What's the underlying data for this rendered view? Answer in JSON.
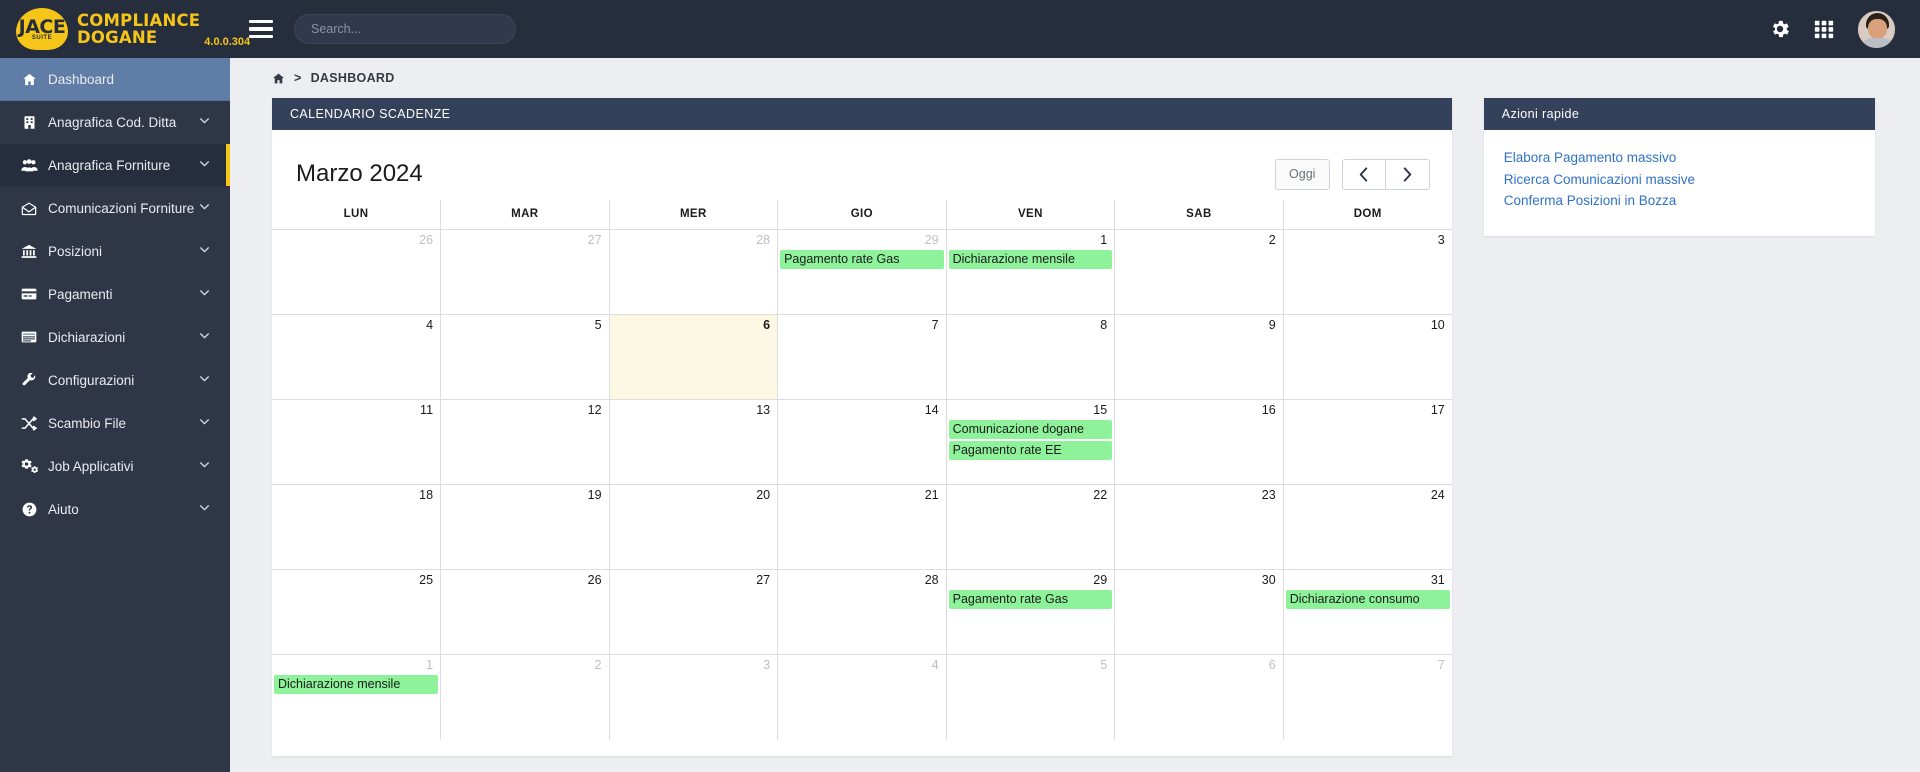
{
  "topbar": {
    "logo_word": "JACE",
    "logo_sub": "SUITE",
    "brand_line1": "COMPLIANCE",
    "brand_line2": "DOGANE",
    "version": "4.0.0.304",
    "search_placeholder": "Search...",
    "search_value": "",
    "icons": [
      "gear-icon",
      "grid-apps-icon",
      "user-avatar"
    ]
  },
  "sidebar": {
    "items": [
      {
        "label": "Dashboard",
        "icon": "home-icon",
        "caret": false,
        "state": "active"
      },
      {
        "label": "Anagrafica Cod. Ditta",
        "icon": "building-icon",
        "caret": true,
        "state": "normal"
      },
      {
        "label": "Anagrafica Forniture",
        "icon": "users-icon",
        "caret": true,
        "state": "hovered"
      },
      {
        "label": "Comunicazioni Forniture",
        "icon": "envelope-icon",
        "caret": true,
        "state": "normal"
      },
      {
        "label": "Posizioni",
        "icon": "bank-icon",
        "caret": true,
        "state": "normal"
      },
      {
        "label": "Pagamenti",
        "icon": "card-icon",
        "caret": true,
        "state": "normal"
      },
      {
        "label": "Dichiarazioni",
        "icon": "list-icon",
        "caret": true,
        "state": "normal"
      },
      {
        "label": "Configurazioni",
        "icon": "wrench-icon",
        "caret": true,
        "state": "normal"
      },
      {
        "label": "Scambio File",
        "icon": "shuffle-icon",
        "caret": true,
        "state": "normal"
      },
      {
        "label": "Job Applicativi",
        "icon": "cogs-icon",
        "caret": true,
        "state": "normal"
      },
      {
        "label": "Aiuto",
        "icon": "question-icon",
        "caret": true,
        "state": "normal"
      }
    ]
  },
  "breadcrumb": {
    "home_icon": "home-icon",
    "separator": ">",
    "current": "DASHBOARD"
  },
  "calendar_panel": {
    "header": "CALENDARIO SCADENZE",
    "title": "Marzo 2024",
    "today_label": "Oggi",
    "prev_label": "‹",
    "next_label": "›",
    "weekdays": [
      "LUN",
      "MAR",
      "MER",
      "GIO",
      "VEN",
      "SAB",
      "DOM"
    ],
    "event_color": "#8ef29a",
    "today_color": "#fcf8e3",
    "weeks": [
      [
        {
          "day": "26",
          "other": true,
          "today": false,
          "events": []
        },
        {
          "day": "27",
          "other": true,
          "today": false,
          "events": []
        },
        {
          "day": "28",
          "other": true,
          "today": false,
          "events": []
        },
        {
          "day": "29",
          "other": true,
          "today": false,
          "events": [
            "Pagamento rate Gas"
          ]
        },
        {
          "day": "1",
          "other": false,
          "today": false,
          "events": [
            "Dichiarazione mensile"
          ]
        },
        {
          "day": "2",
          "other": false,
          "today": false,
          "events": []
        },
        {
          "day": "3",
          "other": false,
          "today": false,
          "events": []
        }
      ],
      [
        {
          "day": "4",
          "other": false,
          "today": false,
          "events": []
        },
        {
          "day": "5",
          "other": false,
          "today": false,
          "events": []
        },
        {
          "day": "6",
          "other": false,
          "today": true,
          "events": []
        },
        {
          "day": "7",
          "other": false,
          "today": false,
          "events": []
        },
        {
          "day": "8",
          "other": false,
          "today": false,
          "events": []
        },
        {
          "day": "9",
          "other": false,
          "today": false,
          "events": []
        },
        {
          "day": "10",
          "other": false,
          "today": false,
          "events": []
        }
      ],
      [
        {
          "day": "11",
          "other": false,
          "today": false,
          "events": []
        },
        {
          "day": "12",
          "other": false,
          "today": false,
          "events": []
        },
        {
          "day": "13",
          "other": false,
          "today": false,
          "events": []
        },
        {
          "day": "14",
          "other": false,
          "today": false,
          "events": []
        },
        {
          "day": "15",
          "other": false,
          "today": false,
          "events": [
            "Comunicazione dogane",
            "Pagamento rate EE"
          ]
        },
        {
          "day": "16",
          "other": false,
          "today": false,
          "events": []
        },
        {
          "day": "17",
          "other": false,
          "today": false,
          "events": []
        }
      ],
      [
        {
          "day": "18",
          "other": false,
          "today": false,
          "events": []
        },
        {
          "day": "19",
          "other": false,
          "today": false,
          "events": []
        },
        {
          "day": "20",
          "other": false,
          "today": false,
          "events": []
        },
        {
          "day": "21",
          "other": false,
          "today": false,
          "events": []
        },
        {
          "day": "22",
          "other": false,
          "today": false,
          "events": []
        },
        {
          "day": "23",
          "other": false,
          "today": false,
          "events": []
        },
        {
          "day": "24",
          "other": false,
          "today": false,
          "events": []
        }
      ],
      [
        {
          "day": "25",
          "other": false,
          "today": false,
          "events": []
        },
        {
          "day": "26",
          "other": false,
          "today": false,
          "events": []
        },
        {
          "day": "27",
          "other": false,
          "today": false,
          "events": []
        },
        {
          "day": "28",
          "other": false,
          "today": false,
          "events": []
        },
        {
          "day": "29",
          "other": false,
          "today": false,
          "events": [
            "Pagamento rate Gas"
          ]
        },
        {
          "day": "30",
          "other": false,
          "today": false,
          "events": []
        },
        {
          "day": "31",
          "other": false,
          "today": false,
          "events": [
            "Dichiarazione consumo"
          ]
        }
      ],
      [
        {
          "day": "1",
          "other": true,
          "today": false,
          "events": [
            "Dichiarazione mensile"
          ]
        },
        {
          "day": "2",
          "other": true,
          "today": false,
          "events": []
        },
        {
          "day": "3",
          "other": true,
          "today": false,
          "events": []
        },
        {
          "day": "4",
          "other": true,
          "today": false,
          "events": []
        },
        {
          "day": "5",
          "other": true,
          "today": false,
          "events": []
        },
        {
          "day": "6",
          "other": true,
          "today": false,
          "events": []
        },
        {
          "day": "7",
          "other": true,
          "today": false,
          "events": []
        }
      ]
    ]
  },
  "quick_actions": {
    "header": "Azioni rapide",
    "link_color": "#2f72c4",
    "links": [
      "Elabora Pagamento massivo",
      "Ricerca Comunicazioni massive",
      "Conferma Posizioni in Bozza"
    ]
  }
}
